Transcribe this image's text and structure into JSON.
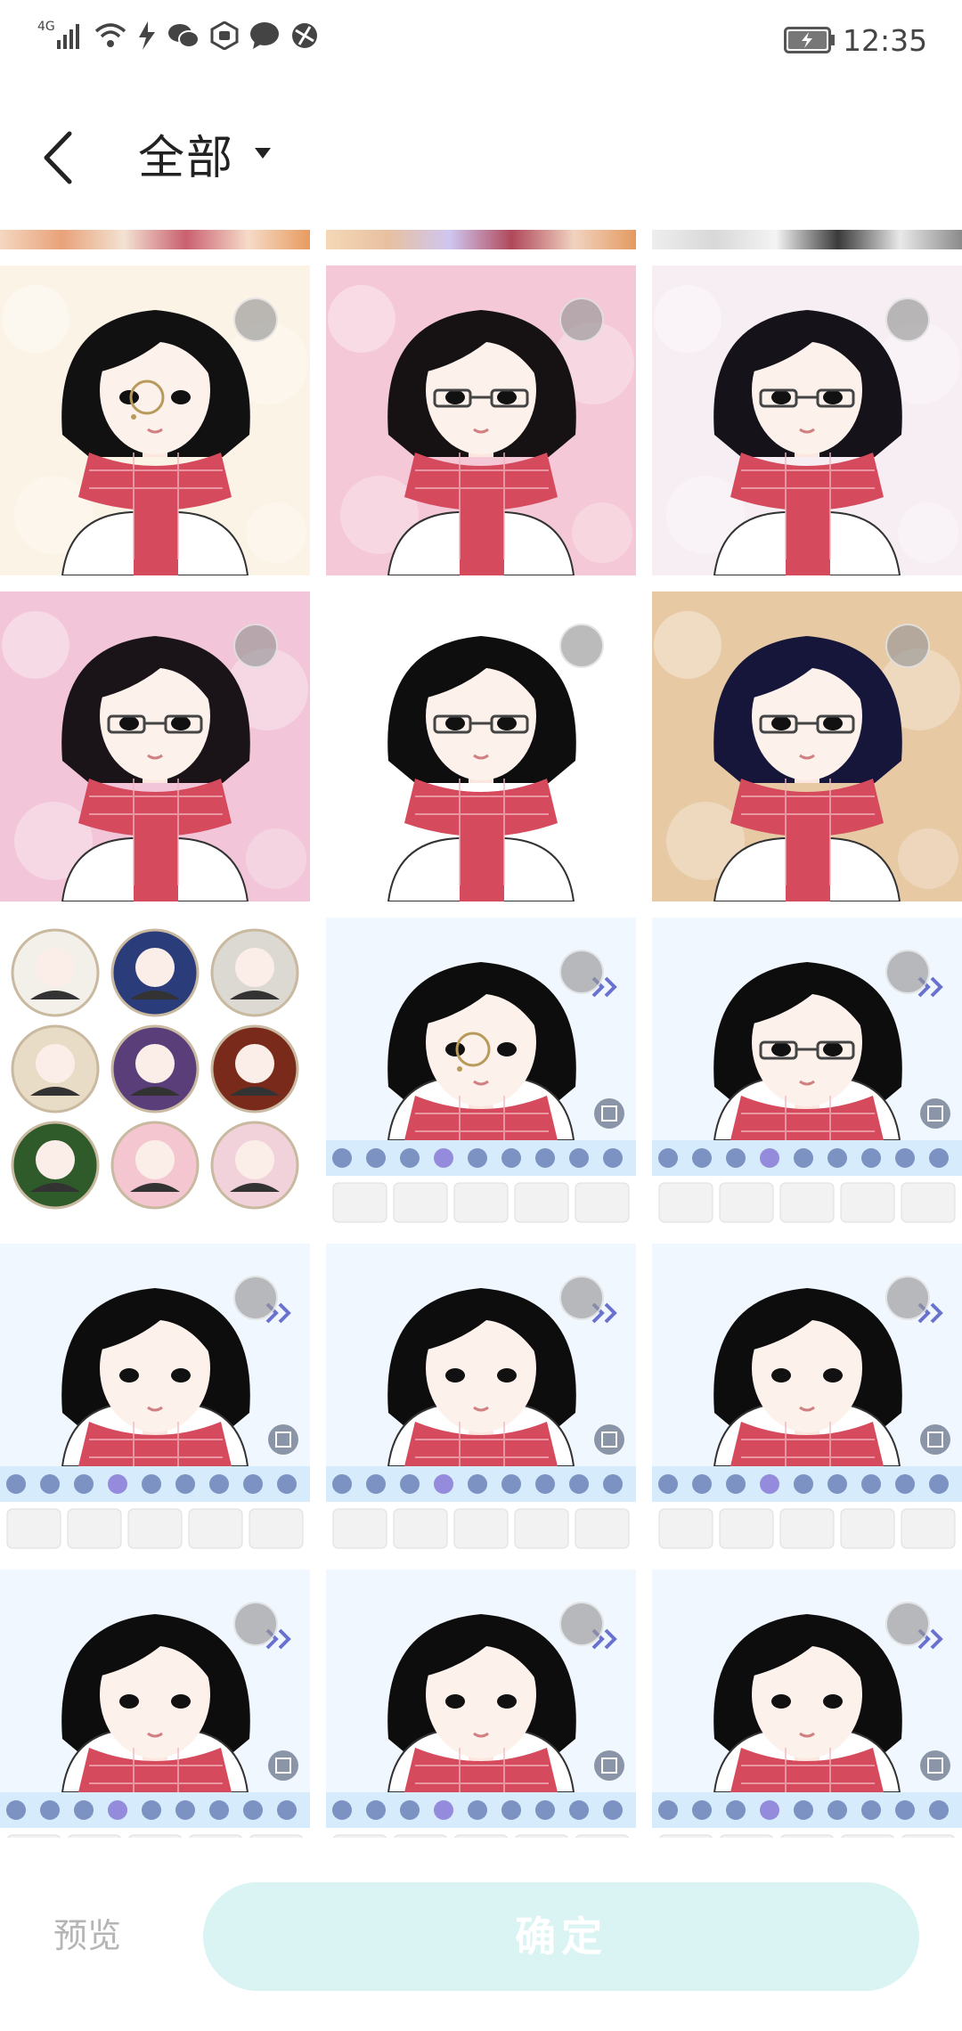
{
  "status_bar": {
    "network": "4G",
    "time": "12:35",
    "icons": [
      "signal-icon",
      "wifi-icon",
      "bolt-icon",
      "wechat-icon",
      "app-badge-icon",
      "chat-bubble-icon",
      "browser-icon",
      "battery-charging-icon"
    ]
  },
  "header": {
    "back_icon": "back-arrow-icon",
    "title": "全部",
    "dropdown_icon": "dropdown-caret-icon"
  },
  "gallery": {
    "items": [
      {
        "kind": "portrait",
        "bg": "#fbf3e6",
        "hair": "#111111",
        "glasses": "round",
        "selectable": true
      },
      {
        "kind": "portrait",
        "bg": "#f4c8d6",
        "hair": "#161214",
        "glasses": "rect",
        "selectable": true
      },
      {
        "kind": "portrait",
        "bg": "#f7eef4",
        "hair": "#15121a",
        "glasses": "rect",
        "selectable": true
      },
      {
        "kind": "portrait",
        "bg": "#f2c6d8",
        "hair": "#1a1418",
        "glasses": "rect",
        "selectable": true
      },
      {
        "kind": "portrait",
        "bg": "#ffffff",
        "hair": "#0e0e0e",
        "glasses": "rect",
        "selectable": true
      },
      {
        "kind": "portrait",
        "bg": "#e7c9a4",
        "hair": "#15163a",
        "glasses": "rect",
        "selectable": true
      },
      {
        "kind": "avatar-set",
        "bg": "#ffffff",
        "selectable": false
      },
      {
        "kind": "editor",
        "bg": "#f0f7ff",
        "hair": "#0d0d0d",
        "glasses": "round",
        "selectable": true
      },
      {
        "kind": "editor",
        "bg": "#f0f7ff",
        "hair": "#0d0d0d",
        "glasses": "rect",
        "selectable": true
      },
      {
        "kind": "editor",
        "bg": "#f0f7ff",
        "hair": "#0d0d0d",
        "glasses": "none",
        "selectable": true
      },
      {
        "kind": "editor",
        "bg": "#f0f7ff",
        "hair": "#0d0d0d",
        "glasses": "none",
        "selectable": true
      },
      {
        "kind": "editor",
        "bg": "#f0f7ff",
        "hair": "#0d0d0d",
        "glasses": "none",
        "selectable": true
      },
      {
        "kind": "editor",
        "bg": "#f0f7ff",
        "hair": "#0d0d0d",
        "glasses": "none",
        "selectable": true
      },
      {
        "kind": "editor",
        "bg": "#f0f7ff",
        "hair": "#0d0d0d",
        "glasses": "none",
        "selectable": true
      },
      {
        "kind": "editor",
        "bg": "#f0f7ff",
        "hair": "#0d0d0d",
        "glasses": "none",
        "selectable": true
      }
    ]
  },
  "bottom_bar": {
    "preview_label": "预览",
    "confirm_label": "确定"
  },
  "colors": {
    "confirm_bg": "#daf3f3",
    "preview_text": "#b5b5b5",
    "scarf": "#d64a5e"
  }
}
